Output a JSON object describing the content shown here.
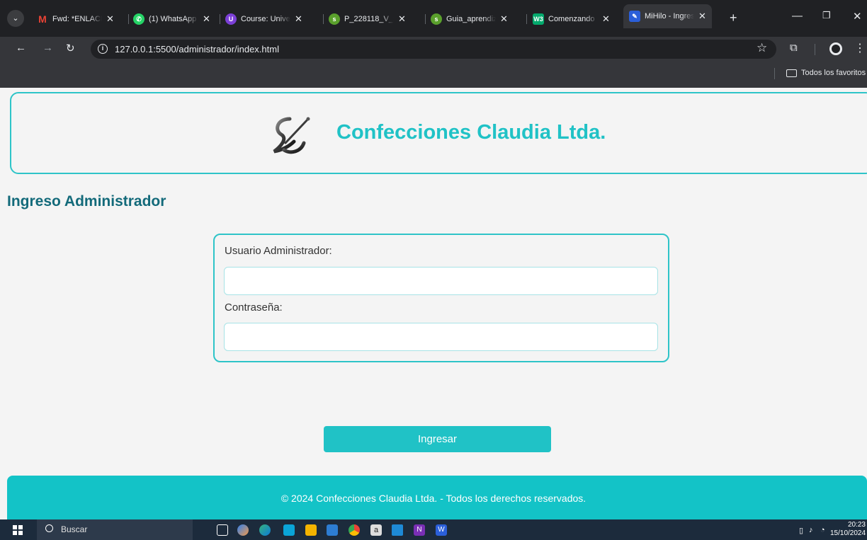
{
  "browser": {
    "tabs": [
      {
        "title": "Fwd: *ENLACE",
        "icon": "gmail-icon",
        "color": "#ea4335"
      },
      {
        "title": "(1) WhatsApp",
        "icon": "whatsapp-icon",
        "color": "#25d366"
      },
      {
        "title": "Course: Univer",
        "icon": "course-icon",
        "color": "#7b3fd6"
      },
      {
        "title": "P_228118_V_2",
        "icon": "document-icon",
        "color": "#5aa02c"
      },
      {
        "title": "Guia_aprendiz",
        "icon": "document-icon",
        "color": "#5aa02c"
      },
      {
        "title": "Comenzando",
        "icon": "w3schools-icon",
        "color": "#04aa6d"
      },
      {
        "title": "MiHilo - Ingres",
        "icon": "page-icon",
        "color": "#2b5fd9"
      }
    ],
    "url": "127.0.0.1:5500/administrador/index.html",
    "bookmarks_label": "Todos los favoritos"
  },
  "page": {
    "brand": "Confecciones Claudia Ltda.",
    "title": "Ingreso Administrador",
    "form": {
      "user_label": "Usuario Administrador:",
      "user_value": "",
      "password_label": "Contraseña:",
      "password_value": ""
    },
    "submit_label": "Ingresar",
    "footer": "© 2024 Confecciones Claudia Ltda. - Todos los derechos reservados."
  },
  "taskbar": {
    "search_placeholder": "Buscar",
    "time": "20:23",
    "date": "15/10/2024"
  },
  "colors": {
    "accent": "#20c2c6",
    "title": "#136a7a",
    "footer": "#13c3c7"
  }
}
